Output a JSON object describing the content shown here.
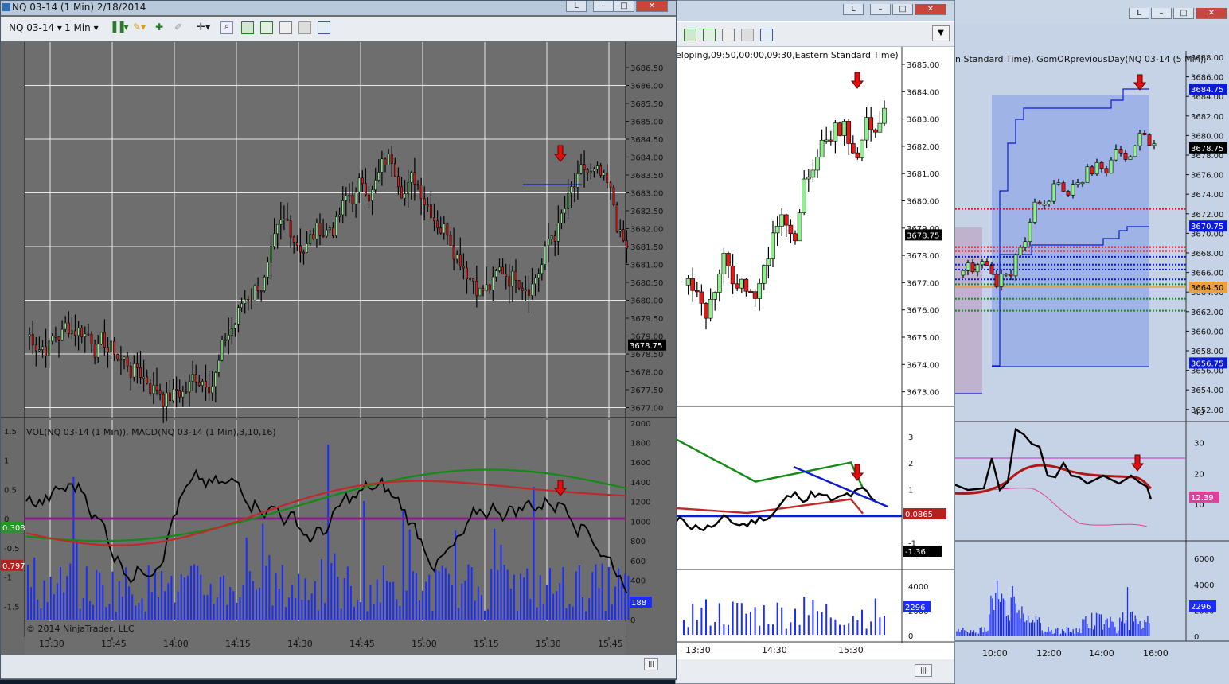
{
  "window1": {
    "title": "NQ 03-14 (1 Min)  2/18/2014",
    "minimize": "L",
    "instrument": "NQ 03-14",
    "interval": "1 Min",
    "price_axis": [
      "3686.50",
      "3686.00",
      "3685.50",
      "3685.00",
      "3684.50",
      "3684.00",
      "3683.50",
      "3683.00",
      "3682.50",
      "3682.00",
      "3681.50",
      "3681.00",
      "3680.50",
      "3680.00",
      "3679.50",
      "3679.00",
      "3678.50",
      "3678.00",
      "3677.50",
      "3677.00"
    ],
    "last_price": "3678.75",
    "indicator_label": "VOL(NQ 03-14 (1 Min)), MACD(NQ 03-14 (1 Min),3,10,16)",
    "macd_axis": [
      "1.5",
      "1",
      "0.5",
      "0",
      "-0.5",
      "-1",
      "-1.5"
    ],
    "vol_axis": [
      "2000",
      "1800",
      "1600",
      "1400",
      "1200",
      "1000",
      "800",
      "600",
      "400",
      "200",
      "0"
    ],
    "macd_badge_1": "0.308",
    "macd_badge_2": "0.797",
    "vol_badge": "188",
    "copyright": "© 2014 NinjaTrader, LLC",
    "time_axis": [
      "13:30",
      "13:45",
      "14:00",
      "14:15",
      "14:30",
      "14:45",
      "15:00",
      "15:15",
      "15:30",
      "15:45"
    ]
  },
  "window2": {
    "minimize": "L",
    "chart_label": "eloping,09:50,00:00,09:30,Eastern Standard Time)",
    "price_axis": [
      "3685.00",
      "3684.00",
      "3683.00",
      "3682.00",
      "3681.00",
      "3680.00",
      "3679.00",
      "3678.00",
      "3677.00",
      "3676.00",
      "3675.00",
      "3674.00",
      "3673.00"
    ],
    "last_price": "3678.75",
    "osc_axis": [
      "3",
      "2",
      "1",
      "0",
      "-1"
    ],
    "osc_badge_1": "0.0865",
    "osc_badge_2": "-1.36",
    "vol_axis": [
      "4000",
      "2000",
      "0"
    ],
    "vol_badge": "2296",
    "time_axis": [
      "13:30",
      "14:30",
      "15:30"
    ]
  },
  "window3": {
    "minimize": "L",
    "chart_label": "n Standard Time), GomORpreviousDay(NQ 03-14 (5 Min),",
    "price_axis": [
      "3688.00",
      "3686.00",
      "3684.00",
      "3682.00",
      "3680.00",
      "3678.00",
      "3676.00",
      "3674.00",
      "3672.00",
      "3670.00",
      "3668.00",
      "3666.00",
      "3664.00",
      "3662.00",
      "3660.00",
      "3658.00",
      "3656.00",
      "3654.00",
      "3652.00"
    ],
    "badge_top": "3684.75",
    "badge_last": "3678.75",
    "badge_mid": "3670.75",
    "badge_orange": "3664.50",
    "badge_low": "3656.75",
    "osc_axis": [
      "40",
      "30",
      "20",
      "10"
    ],
    "osc_badge": "12.39",
    "vol_axis": [
      "6000",
      "4000",
      "2000",
      "0"
    ],
    "vol_badge": "2296",
    "time_axis": [
      "10:00",
      "12:00",
      "14:00",
      "16:00"
    ]
  },
  "colors": {
    "chart_bg_dark": "#6e6e6e",
    "up_candle": "#90ee90",
    "down_candle": "#e31b1b",
    "volume": "#1b2cff",
    "macd_line": "#000000",
    "signal_green": "#138a13",
    "signal_red": "#c0282c",
    "zero_line": "#8b1c8b",
    "value_area": "#9fb3e6"
  }
}
